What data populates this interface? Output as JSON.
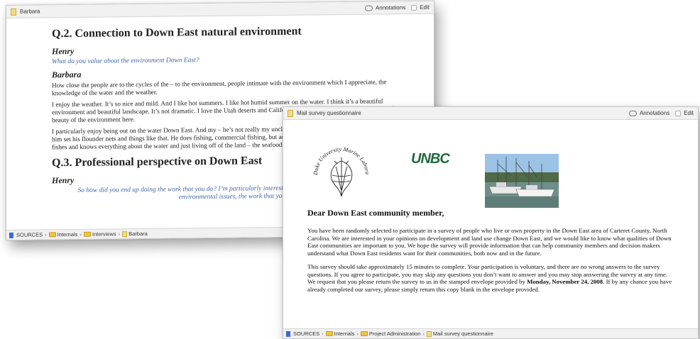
{
  "barbara_window": {
    "title": "Barbara",
    "annotations_label": "Annotations",
    "edit_label": "Edit",
    "heading_q2": "Q.2. Connection to Down East natural environment",
    "speaker_1": "Henry",
    "question_1": "What do you value about the environment Down East?",
    "speaker_2": "Barbara",
    "para_1": "How close the people are to the cycles of the – to the environment, people intimate with the environment which I appreciate, the knowledge of the water and the weather.",
    "para_2": "I enjoy the weather. It’s so nice and mild. And I like hot summers. I like hot humid summer on the water. I think it’s a beautiful environment and beautiful landscape. It’s not dramatic. I love the Utah deserts and California. But I like this subtle, sublime sort of beauty of the environment here.",
    "para_3": "I particularly enjoy being out on the water Down East. And my – he’s not really my uncle, but a friend who I call an uncle – I just help him set his flounder nets and things like that. He does fishing, commercial fishing, but actually he’s not commercial, just for his own, he fishes and knows everything about the water and just living off of the land – the seafood.",
    "heading_q3": "Q.3. Professional perspective on Down East",
    "speaker_3": "Henry",
    "question_3": "So how did you end up doing the work that you do? I’m particularly interested in... an interview focused on sort of environmental issues, the work that you",
    "breadcrumb": [
      "SOURCES",
      "Internals",
      "Interviews",
      "Barbara"
    ]
  },
  "survey_window": {
    "title": "Mail survey questionnaire",
    "annotations_label": "Annotations",
    "edit_label": "Edit",
    "logo_text": "Duke University Marine Laboratory",
    "unbc_text": "UNBC",
    "greeting": "Dear Down East community member,",
    "para_1": "You have been randomly selected to participate in a survey of people who live or own property in the Down East area of Carteret County, North Carolina.  We are interested in your opinions on development and land use change Down East, and we would like to know what qualities of Down East communities are important to you.  We hope the survey will provide information that can help community members and decision makers understand what Down East residents want for their communities, both now and in the future.",
    "para_2_a": "This survey should take approximately 15 minutes to complete. Your participation is voluntary, and there are no wrong answers to the survey questions. If you agree to participate, you may skip any questions you don’t want to answer and you may stop answering the survey at any time. We request that you please return the survey to us in the stamped envelope provided by ",
    "para_2_bold": "Monday, November 24, 2008",
    "para_2_b": ". If by any chance you have already completed our survey, please simply return this copy blank in the envelope provided.",
    "breadcrumb": [
      "SOURCES",
      "Internals",
      "Project Administration",
      "Mail survey questionnaire"
    ]
  }
}
